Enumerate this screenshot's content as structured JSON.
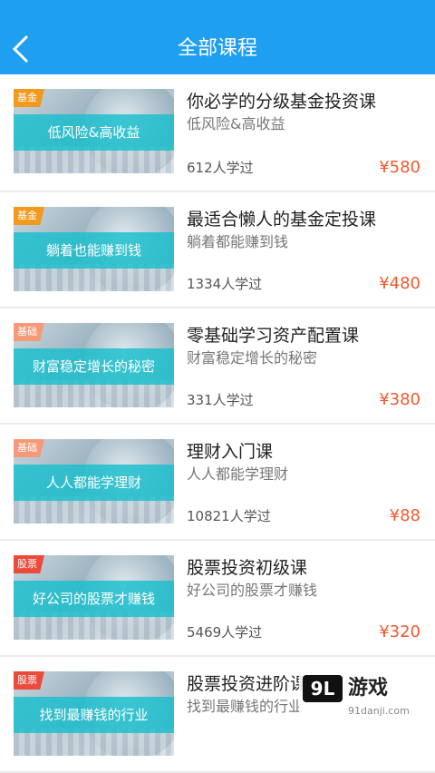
{
  "header": {
    "title": "全部课程",
    "back_icon": "chevron-left-icon",
    "color": "#1e9ff0"
  },
  "colors": {
    "price": "#ef5a2f",
    "tag_fund": "#f19a1c",
    "tag_basic": "#f59a79",
    "tag_stock": "#ea4b3a",
    "band": "#19bec9"
  },
  "courses": [
    {
      "tag": "基金",
      "banner": "低风险&高收益",
      "title": "你必学的分级基金投资课",
      "subtitle": "低风险&高收益",
      "learners": "612人学过",
      "price": "¥580"
    },
    {
      "tag": "基金",
      "banner": "躺着也能赚到钱",
      "title": "最适合懒人的基金定投课",
      "subtitle": "躺着都能赚到钱",
      "learners": "1334人学过",
      "price": "¥480"
    },
    {
      "tag": "基础",
      "banner": "财富稳定增长的秘密",
      "title": "零基础学习资产配置课",
      "subtitle": "财富稳定增长的秘密",
      "learners": "331人学过",
      "price": "¥380"
    },
    {
      "tag": "基础",
      "banner": "人人都能学理财",
      "title": "理财入门课",
      "subtitle": "人人都能学理财",
      "learners": "10821人学过",
      "price": "¥88"
    },
    {
      "tag": "股票",
      "banner": "好公司的股票才赚钱",
      "title": "股票投资初级课",
      "subtitle": "好公司的股票才赚钱",
      "learners": "5469人学过",
      "price": "¥320"
    },
    {
      "tag": "股票",
      "banner": "找到最赚钱的行业",
      "title": "股票投资进阶课",
      "subtitle": "找到最赚钱的行业",
      "learners": "",
      "price": ""
    }
  ],
  "watermark": {
    "logo": "9L",
    "name": "游戏",
    "url": "91danji.com"
  }
}
